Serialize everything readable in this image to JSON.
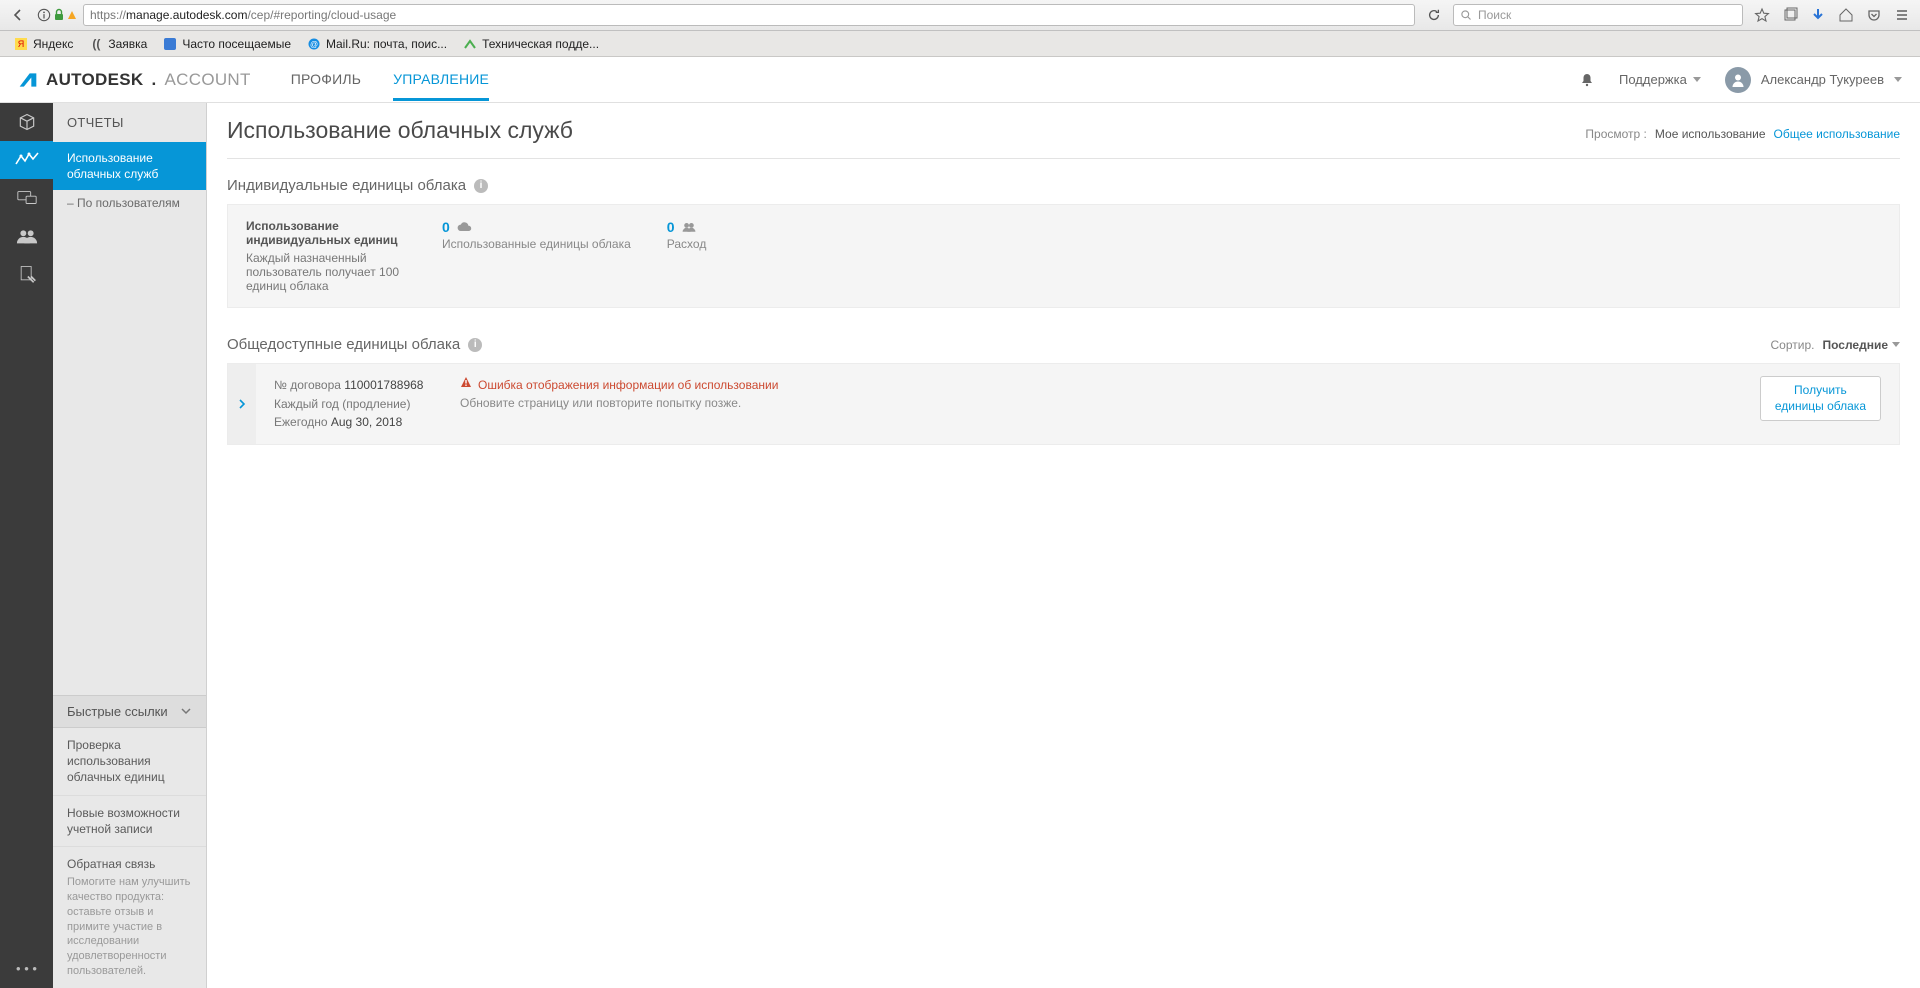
{
  "browser": {
    "url_prefix": "https://",
    "url_domain": "manage.autodesk.com",
    "url_path": "/cep/#reporting/cloud-usage",
    "search_placeholder": "Поиск",
    "bookmarks": [
      {
        "label": "Яндекс",
        "color": "#ff0000"
      },
      {
        "label": "Заявка",
        "color": "#333"
      },
      {
        "label": "Часто посещаемые",
        "color": "#3a7bd5"
      },
      {
        "label": "Mail.Ru: почта, поис...",
        "color": "#168de2"
      },
      {
        "label": "Техническая подде...",
        "color": "#4caf50"
      }
    ]
  },
  "header": {
    "logo_main": "AUTODESK",
    "logo_sub": "ACCOUNT",
    "tabs": [
      {
        "label": "ПРОФИЛЬ",
        "active": false
      },
      {
        "label": "УПРАВЛЕНИЕ",
        "active": true
      }
    ],
    "support": "Поддержка",
    "user": "Александр Тукуреев"
  },
  "sidebar": {
    "title": "ОТЧЕТЫ",
    "items": [
      {
        "label": "Использование облачных служб",
        "active": true
      },
      {
        "label": "– По пользователям",
        "active": false
      }
    ],
    "quick_links_title": "Быстрые ссылки",
    "quick_links": [
      {
        "label": "Проверка использования облачных единиц"
      },
      {
        "label": "Новые возможности учетной записи"
      },
      {
        "label": "Обратная связь",
        "desc": "Помогите нам улучшить качество продукта: оставьте отзыв и примите участие в исследовании удовлетворенности пользователей."
      }
    ]
  },
  "main": {
    "page_title": "Использование облачных служб",
    "view_label": "Просмотр :",
    "view_my": "Мое использование",
    "view_shared": "Общее использование",
    "section1_title": "Индивидуальные единицы облака",
    "ind_usage_title": "Использование индивидуальных единиц",
    "ind_usage_desc": "Каждый назначенный пользователь получает 100 единиц облака",
    "used_value": "0",
    "used_label": "Использованные единицы облака",
    "expense_value": "0",
    "expense_label": "Расход",
    "section2_title": "Общедоступные единицы облака",
    "sort_label": "Сортир.",
    "sort_value": "Последние",
    "contract_label": "№ договора",
    "contract_num": "110001788968",
    "contract_period": "Каждый год (продление)",
    "contract_renew_prefix": "Ежегодно",
    "contract_renew_date": "Aug 30, 2018",
    "error_title": "Ошибка отображения информации об использовании",
    "error_desc": "Обновите страницу или повторите попытку позже.",
    "get_credits_l1": "Получить",
    "get_credits_l2": "единицы облака"
  }
}
